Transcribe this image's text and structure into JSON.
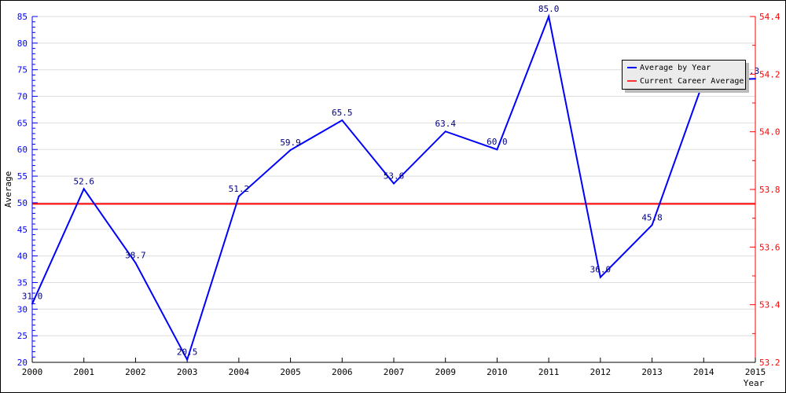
{
  "chart_data": {
    "type": "line",
    "title": "",
    "xlabel": "Year",
    "ylabel": "Average",
    "categories": [
      "2000",
      "2001",
      "2002",
      "2003",
      "2004",
      "2005",
      "2006",
      "2007",
      "2009",
      "2010",
      "2011",
      "2012",
      "2013",
      "2014",
      "2015"
    ],
    "series": [
      {
        "name": "Average by Year",
        "color": "#0000ff",
        "axis": "left",
        "values": [
          31.0,
          52.6,
          38.7,
          20.5,
          51.2,
          59.9,
          65.5,
          53.6,
          63.4,
          60.0,
          85.0,
          36.0,
          45.8,
          73.0,
          73.3
        ],
        "labels": [
          "31.0",
          "52.6",
          "38.7",
          "20.5",
          "51.2",
          "59.9",
          "65.5",
          "53.6",
          "63.4",
          "60.0",
          "85.0",
          "36.0",
          "45.8",
          "",
          "73.3"
        ]
      },
      {
        "name": "Current Career Average",
        "color": "#ff0000",
        "axis": "right",
        "value": 53.75
      }
    ],
    "ylim_left": [
      20,
      85
    ],
    "yticks_left": [
      "20",
      "25",
      "30",
      "35",
      "40",
      "45",
      "50",
      "55",
      "60",
      "65",
      "70",
      "75",
      "80",
      "85"
    ],
    "ylim_right": [
      53.2,
      54.4
    ],
    "yticks_right": [
      "53.2",
      "53.4",
      "53.6",
      "53.8",
      "54.0",
      "54.2",
      "54.4"
    ],
    "grid": true,
    "legend_position": "top-right",
    "left_axis_color": "#0000ff",
    "right_axis_color": "#ff0000"
  }
}
